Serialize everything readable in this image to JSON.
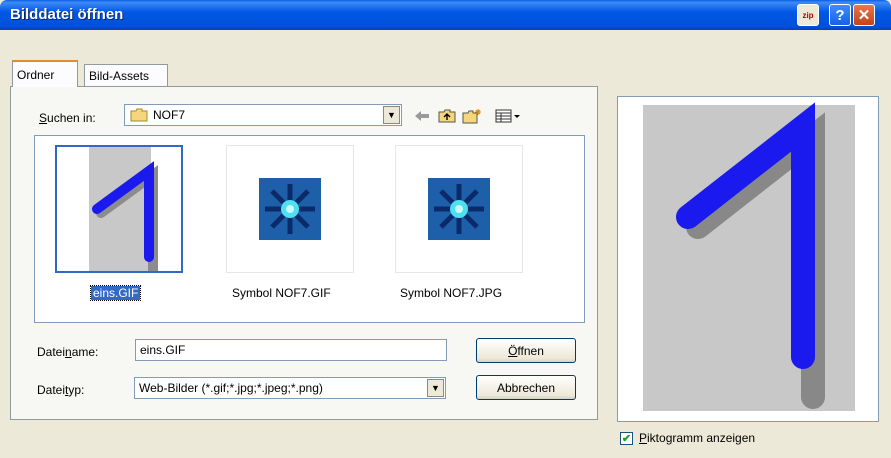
{
  "window": {
    "title": "Bilddatei öffnen",
    "zip_label": "zip",
    "help_label": "?",
    "close_label": "✕"
  },
  "tabs": [
    {
      "label": "Ordner"
    },
    {
      "label": "Bild-Assets"
    }
  ],
  "look_in": {
    "label_prefix": "S",
    "label_rest": "uchen in:",
    "value": "NOF7"
  },
  "files": [
    {
      "name": "eins.GIF",
      "selected": true
    },
    {
      "name": "Symbol NOF7.GIF",
      "selected": false
    },
    {
      "name": "Symbol NOF7.JPG",
      "selected": false
    }
  ],
  "filename": {
    "label_pre": "Datei",
    "label_ul": "n",
    "label_post": "ame:",
    "value": "eins.GIF"
  },
  "filetype": {
    "label_pre": "Datei",
    "label_ul": "t",
    "label_post": "yp:",
    "value": "Web-Bilder (*.gif;*.jpg;*.jpeg;*.png)"
  },
  "buttons": {
    "open_ul": "Ö",
    "open_rest": "ffnen",
    "cancel": "Abbrechen"
  },
  "preview_checkbox": {
    "checked": true,
    "label_ul": "P",
    "label_rest": "iktogramm anzeigen"
  },
  "colors": {
    "selection": "#316ac5",
    "titlebar": "#0058e6",
    "dialog_bg": "#ece9d8"
  }
}
